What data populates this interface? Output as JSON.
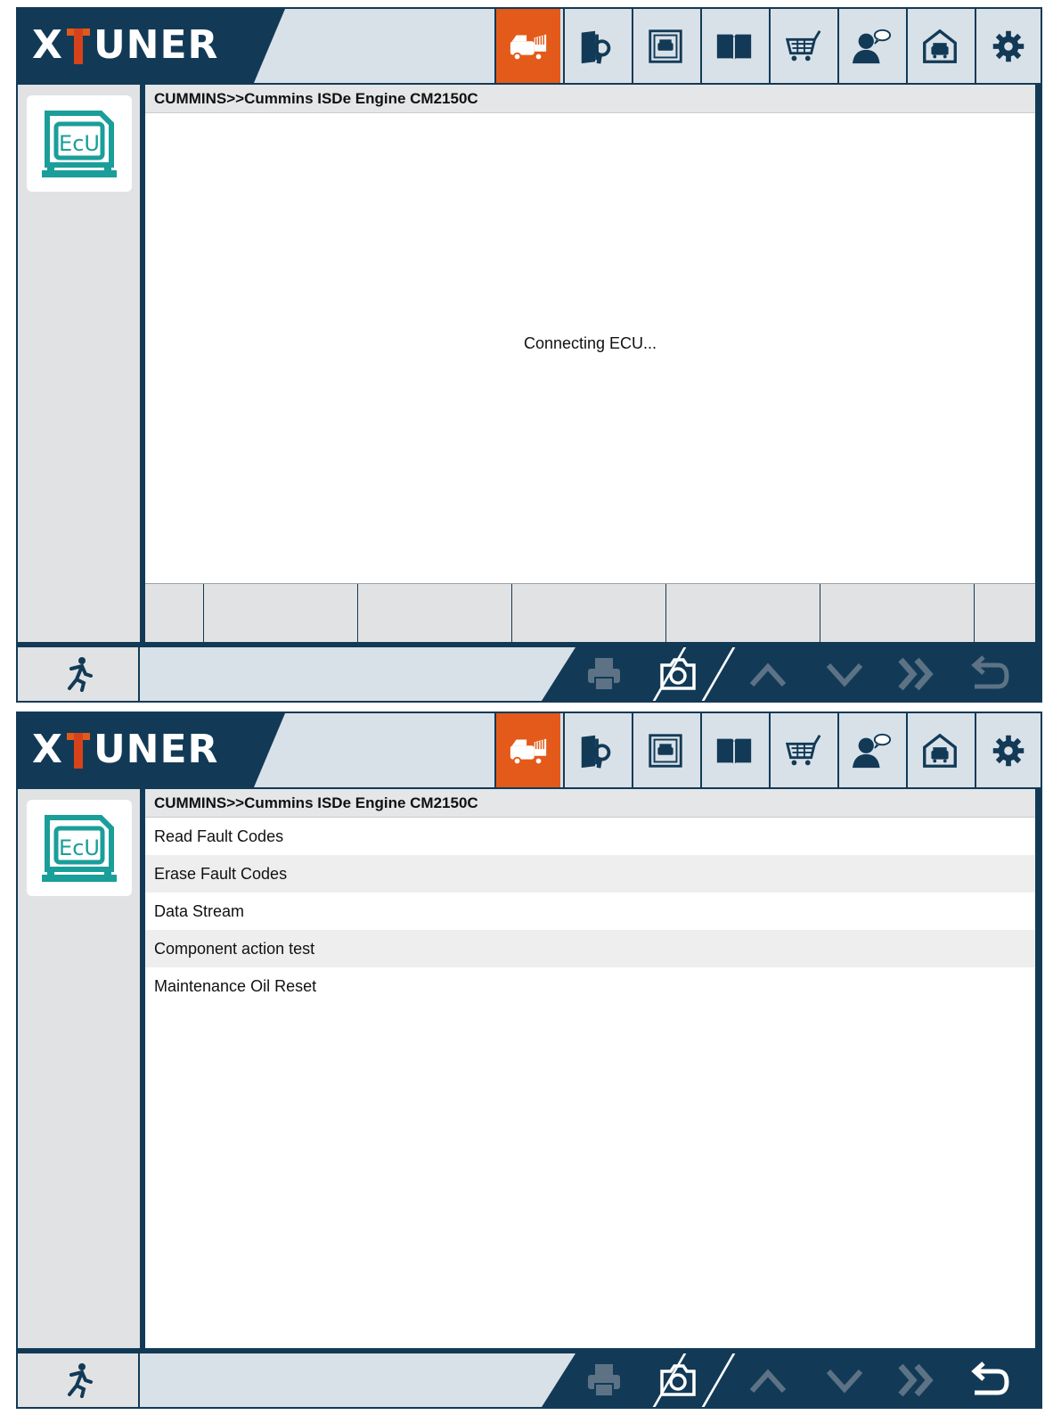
{
  "brand": {
    "name_left": "X",
    "name_right": "UNER"
  },
  "toolbar": {
    "icons": [
      "truck-diagnosis-icon",
      "manual-search-icon",
      "vehicle-report-icon",
      "book-icon",
      "cart-icon",
      "user-feedback-icon",
      "garage-icon",
      "settings-icon"
    ],
    "active": "truck-diagnosis-icon"
  },
  "colors": {
    "navy": "#123a57",
    "accent": "#e35a1a",
    "teal": "#1a9e9a"
  },
  "screen1": {
    "breadcrumb": "CUMMINS>>Cummins ISDe Engine CM2150C",
    "status_message": "Connecting ECU..."
  },
  "screen2": {
    "breadcrumb": "CUMMINS>>Cummins ISDe Engine CM2150C",
    "menu_items": [
      "Read Fault Codes",
      "Erase Fault Codes",
      "Data Stream",
      "Component action test",
      "Maintenance Oil Reset"
    ]
  },
  "nav": {
    "buttons": [
      "print-icon",
      "camera-icon",
      "up-arrow-icon",
      "down-arrow-icon",
      "fast-forward-icon",
      "back-arrow-icon"
    ]
  }
}
